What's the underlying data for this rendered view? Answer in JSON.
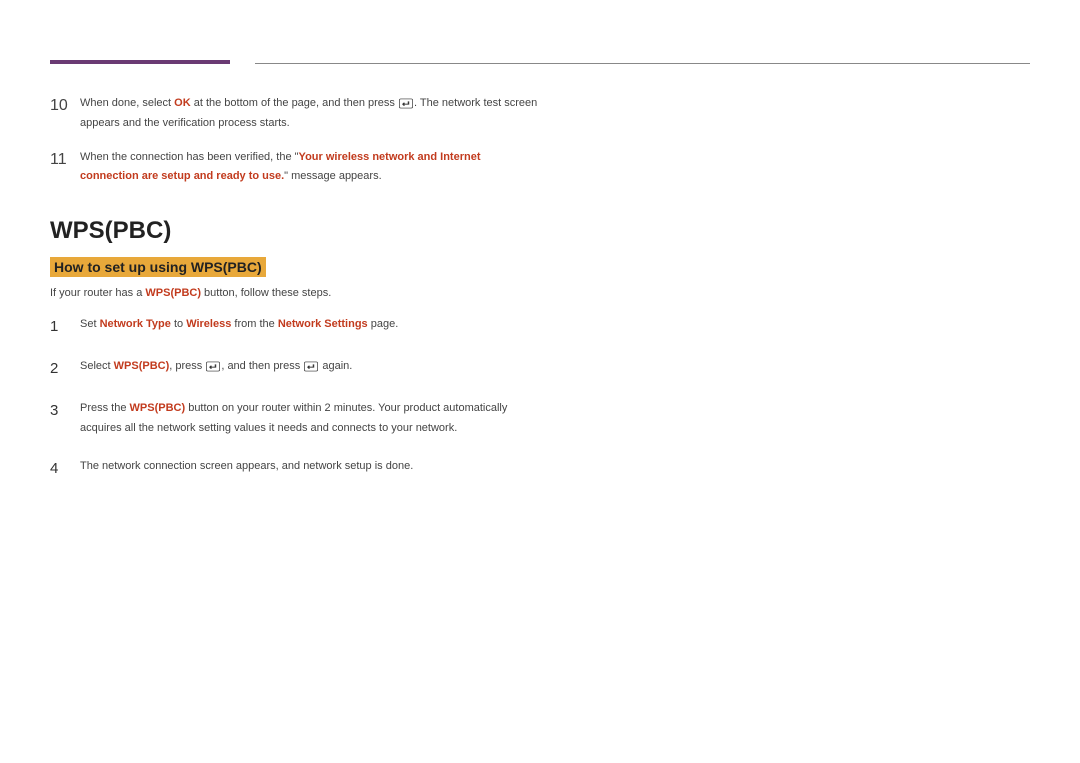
{
  "upper_steps": [
    {
      "num": "10",
      "parts": [
        {
          "t": "When done, select "
        },
        {
          "t": "OK",
          "hl": true
        },
        {
          "t": " at the bottom of the page, and then press "
        },
        {
          "icon": true
        },
        {
          "t": ". The network test screen appears and the verification process starts."
        }
      ]
    },
    {
      "num": "11",
      "parts": [
        {
          "t": "When the connection has been verified, the \""
        },
        {
          "t": "Your wireless network and Internet connection are setup and ready to use.",
          "hl": true
        },
        {
          "t": "\" message appears."
        }
      ]
    }
  ],
  "section": {
    "title": "WPS(PBC)",
    "subtitle": "How to set up using WPS(PBC)",
    "intro_parts": [
      {
        "t": "If your router has a "
      },
      {
        "t": "WPS(PBC)",
        "hl": true
      },
      {
        "t": " button, follow these steps."
      }
    ]
  },
  "lower_steps": [
    {
      "num": "1",
      "parts": [
        {
          "t": "Set "
        },
        {
          "t": "Network Type",
          "hl": true
        },
        {
          "t": " to "
        },
        {
          "t": "Wireless",
          "hl": true
        },
        {
          "t": " from the "
        },
        {
          "t": "Network Settings",
          "hl": true
        },
        {
          "t": " page."
        }
      ]
    },
    {
      "num": "2",
      "parts": [
        {
          "t": "Select "
        },
        {
          "t": "WPS(PBC)",
          "hl": true
        },
        {
          "t": ", press "
        },
        {
          "icon": true
        },
        {
          "t": ", and then press "
        },
        {
          "icon": true
        },
        {
          "t": " again."
        }
      ]
    },
    {
      "num": "3",
      "parts": [
        {
          "t": "Press the "
        },
        {
          "t": "WPS(PBC)",
          "hl": true
        },
        {
          "t": " button on your router within 2 minutes. Your product automatically acquires all the network setting values it needs and connects to your network."
        }
      ]
    },
    {
      "num": "4",
      "parts": [
        {
          "t": "The network connection screen appears, and network setup is done."
        }
      ]
    }
  ]
}
